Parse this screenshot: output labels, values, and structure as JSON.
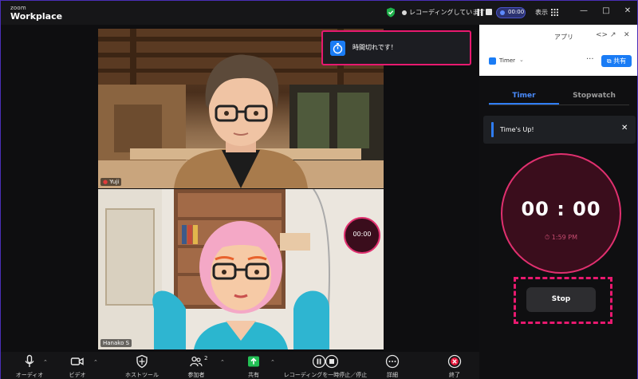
{
  "titlebar": {
    "logo_small": "zoom",
    "logo_big": "Workplace",
    "recording_text": "レコーディングしています...",
    "timer_pill": "00:00",
    "view_label": "表示"
  },
  "participants": [
    {
      "name": "Yuji"
    },
    {
      "name": "Hanako S"
    }
  ],
  "toast": {
    "text": "時間切れです！",
    "icon": "timer-icon"
  },
  "tile_timer": "00:00",
  "toolbar": {
    "audio": "オーディオ",
    "video": "ビデオ",
    "host_tools": "ホストツール",
    "participants": "参加者",
    "participants_count": "2",
    "share": "共有",
    "recording": "レコーディングを一時停止／停止",
    "more": "詳細",
    "end": "終了"
  },
  "panel": {
    "title": "アプリ",
    "app_name": "Timer",
    "share_label": "共有",
    "tabs": [
      {
        "label": "Timer",
        "active": true
      },
      {
        "label": "Stopwatch",
        "active": false
      }
    ],
    "alert": "Time's Up!",
    "dial_time": "00 : 00",
    "end_time": "1:59 PM",
    "stop_label": "Stop"
  },
  "colors": {
    "accent_pink": "#e8196f",
    "accent_blue": "#2f7df5",
    "dial_fill": "#3a0d1c",
    "end_time_red": "#c64c70"
  }
}
